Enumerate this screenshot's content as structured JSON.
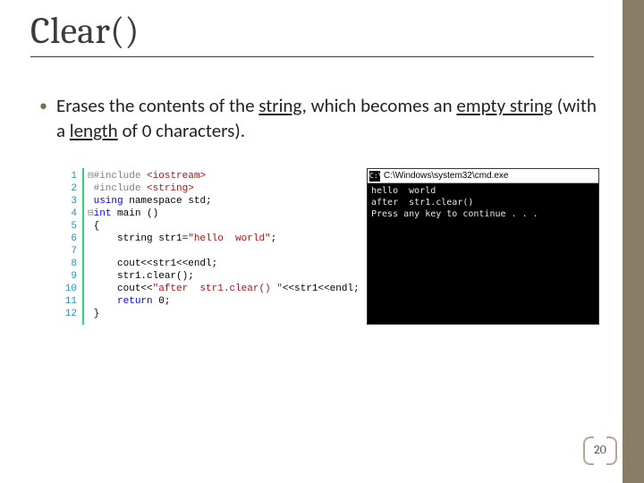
{
  "title": "Clear()",
  "bullet": {
    "prefix": "Erases the contents of the ",
    "u1": "string",
    "mid1": ", which becomes an ",
    "u2": "empty string",
    "mid2": " (with a ",
    "u3": "length",
    "suffix": " of 0 characters)."
  },
  "code": {
    "line_numbers": [
      "1",
      "2",
      "3",
      "4",
      "5",
      "6",
      "7",
      "8",
      "9",
      "10",
      "11",
      "12"
    ],
    "l1_hash": "#include",
    "l1_hdr": " <iostream>",
    "l2_hash": "#include",
    "l2_hdr": " <string>",
    "l3_kw": "using",
    "l3_rest": " namespace std;",
    "l4_kw": "int",
    "l4_rest": " main ()",
    "l5": "{",
    "l6_a": "    string str1=",
    "l6_s": "\"hello  world\"",
    "l6_b": ";",
    "l7": "",
    "l8": "    cout<<str1<<endl;",
    "l9": "    str1.clear();",
    "l10_a": "    cout<<",
    "l10_s": "\"after  str1.clear() \"",
    "l10_b": "<<str1<<endl;",
    "l11_kw": "return",
    "l11_rest": " 0;",
    "l12": "}"
  },
  "console": {
    "title_path": "C:\\Windows\\system32\\cmd.exe",
    "line1": "hello  world",
    "line2": "after  str1.clear()",
    "line3": "Press any key to continue . . ."
  },
  "page_number": "20",
  "fold_open": "⊟",
  "fold_close": "⊟"
}
